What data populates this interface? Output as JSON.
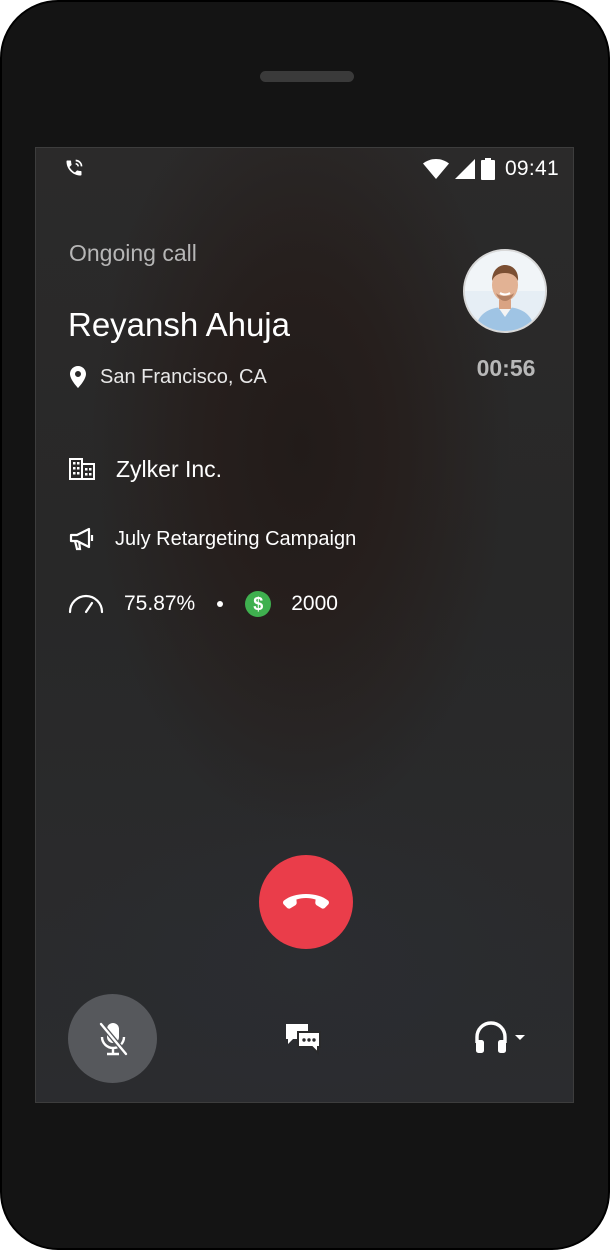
{
  "status_bar": {
    "time": "09:41",
    "icons": [
      "phone-call-icon",
      "wifi-icon",
      "signal-icon",
      "battery-icon"
    ]
  },
  "call": {
    "status_label": "Ongoing call",
    "caller_name": "Reyansh Ahuja",
    "location": "San Francisco, CA",
    "duration": "00:56",
    "company": "Zylker Inc.",
    "campaign": "July Retargeting Campaign",
    "score": "75.87%",
    "amount": "2000",
    "currency_symbol": "$"
  },
  "controls": {
    "end_call": "end-call-icon",
    "mute": "mic-off-icon",
    "chat": "chat-icon",
    "audio": "headphones-icon"
  },
  "colors": {
    "end_call": "#ea3d4a",
    "mute_bg": "#56585c",
    "amount_badge": "#3fb04f"
  }
}
